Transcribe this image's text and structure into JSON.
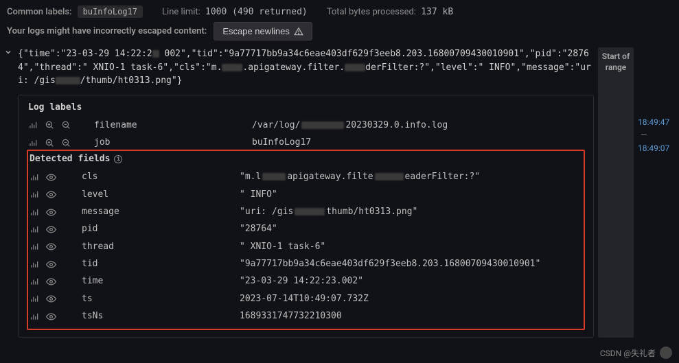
{
  "header": {
    "common_labels_label": "Common labels:",
    "common_labels_value": "buInfoLog17",
    "line_limit_label": "Line limit:",
    "line_limit_value": "1000 (490 returned)",
    "bytes_label": "Total bytes processed:",
    "bytes_value": "137 kB",
    "escape_hint": "Your logs might have incorrectly escaped content:",
    "escape_button": "Escape newlines"
  },
  "log": {
    "json_prefix": "{\"time\":\"23-03-29 14:22:2",
    "json_mid1": " 002\",\"tid\":\"9a77717bb9a34c6eae403df629f3eeb8.203.16800709430010901\",\"pid\":\"28764\",\"thread\":\" XNIO-1 task-6\",\"cls\":\"m.",
    "json_mid2": ".apigateway.filter.",
    "json_mid3": "derFilter:?\",\"level\":\" INFO\",\"message\":\"uri: /gis",
    "json_mid4": "/thumb/ht0313.png\"}",
    "start_of_range": "Start of range"
  },
  "timeline": {
    "t1": "18:49:47",
    "t2": "18:49:07"
  },
  "labels_title": "Log labels",
  "labels": [
    {
      "key": "filename",
      "val_prefix": "/var/log/",
      "val_suffix": " 20230329.0.info.log",
      "redact_w": 62
    },
    {
      "key": "job",
      "val": "buInfoLog17"
    }
  ],
  "detected_title": "Detected fields",
  "detected": [
    {
      "key": "cls",
      "segments": [
        "\"m.l",
        "REDACT:34",
        " apigateway.filte",
        "REDACT:42",
        "eaderFilter:?\""
      ]
    },
    {
      "key": "level",
      "segments": [
        "\" INFO\""
      ]
    },
    {
      "key": "message",
      "segments": [
        "\"uri: /gis",
        "REDACT:44",
        "thumb/ht0313.png\""
      ]
    },
    {
      "key": "pid",
      "segments": [
        "\"28764\""
      ]
    },
    {
      "key": "thread",
      "segments": [
        "\"  XNIO-1 task-6\""
      ]
    },
    {
      "key": "tid",
      "segments": [
        "\"9a77717bb9a34c6eae403df629f3eeb8.203.16800709430010901\""
      ]
    },
    {
      "key": "time",
      "segments": [
        "\"23-03-29 14:22:23.002\""
      ]
    },
    {
      "key": "ts",
      "segments": [
        "2023-07-14T10:49:07.732Z"
      ]
    },
    {
      "key": "tsNs",
      "segments": [
        "1689331747732210300"
      ]
    }
  ],
  "watermark": "CSDN @失礼者"
}
